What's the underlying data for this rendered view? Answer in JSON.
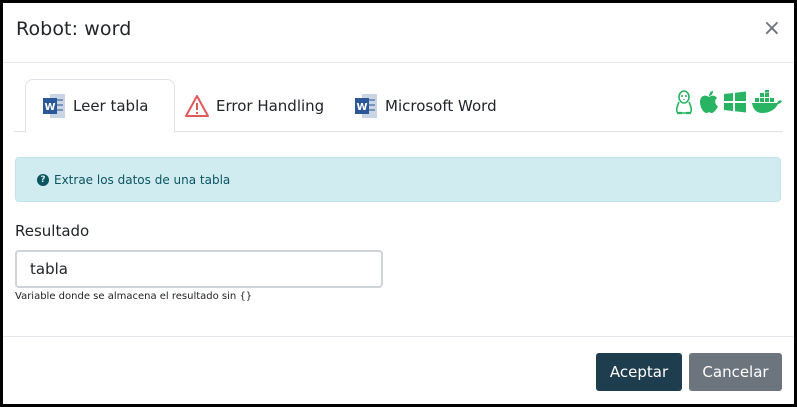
{
  "dialog": {
    "title": "Robot: word",
    "close_label": "×"
  },
  "tabs": [
    {
      "label": "Leer tabla",
      "icon": "word-doc-icon",
      "active": true
    },
    {
      "label": "Error Handling",
      "icon": "warning-triangle-icon",
      "active": false
    },
    {
      "label": "Microsoft Word",
      "icon": "word-doc-icon",
      "active": false
    }
  ],
  "os_icons": [
    "linux-icon",
    "apple-icon",
    "windows-icon",
    "docker-icon"
  ],
  "alert": {
    "icon": "question-circle-icon",
    "text": "Extrae los datos de una tabla"
  },
  "field": {
    "label": "Resultado",
    "value": "tabla",
    "help": "Variable donde se almacena el resultado sin {}"
  },
  "footer": {
    "accept_label": "Aceptar",
    "cancel_label": "Cancelar"
  },
  "colors": {
    "primary": "#1e3d4f",
    "secondary": "#6c757d",
    "alert_bg": "#d1ecf1",
    "os_green": "#28b463"
  }
}
